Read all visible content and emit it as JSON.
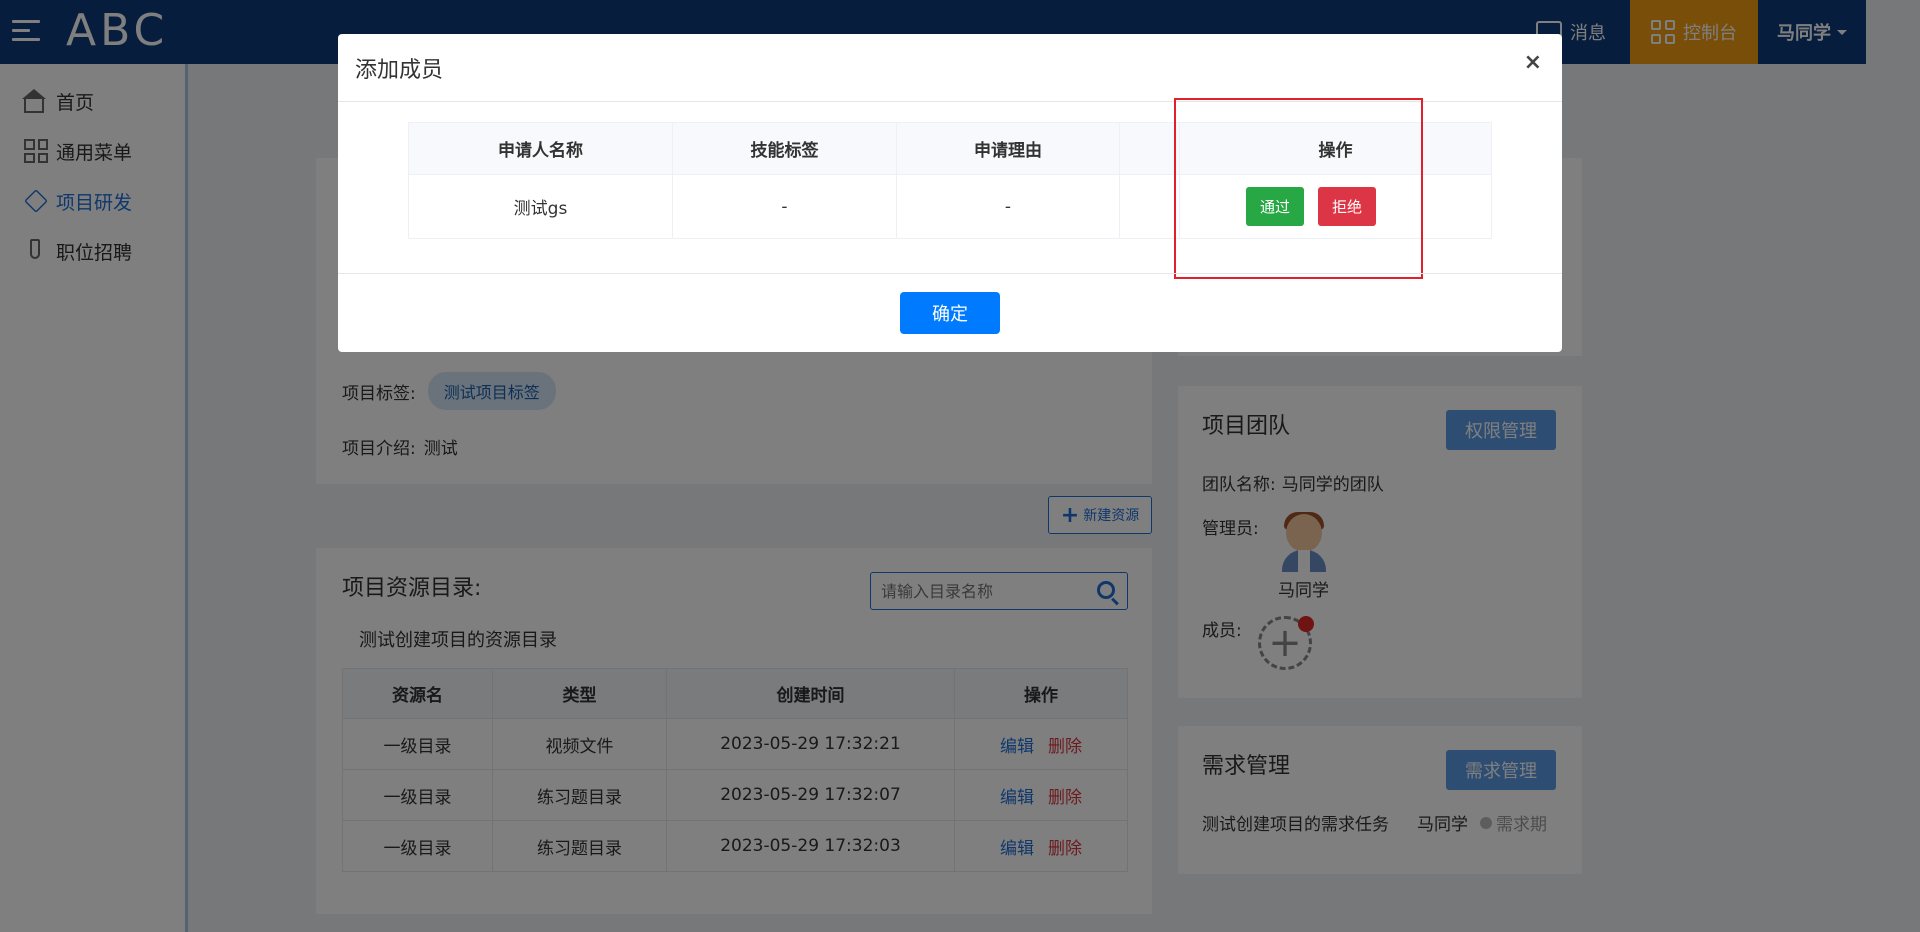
{
  "header": {
    "logo_text": "ABC",
    "message_label": "消息",
    "console_label": "控制台",
    "user_name": "马同学"
  },
  "sidebar": {
    "items": [
      {
        "label": "首页",
        "icon": "home-icon",
        "active": false
      },
      {
        "label": "通用菜单",
        "icon": "grid-icon",
        "active": false
      },
      {
        "label": "项目研发",
        "icon": "layers-icon",
        "active": true
      },
      {
        "label": "职位招聘",
        "icon": "tie-icon",
        "active": false
      }
    ]
  },
  "project": {
    "tags_label": "项目标签:",
    "tag": "测试项目标签",
    "intro_label": "项目介绍:",
    "intro": "测试",
    "new_resource_label": "新建资源"
  },
  "resources": {
    "title": "项目资源目录:",
    "search_placeholder": "请输入目录名称",
    "directory_name": "测试创建项目的资源目录",
    "columns": [
      "资源名",
      "类型",
      "创建时间",
      "操作"
    ],
    "rows": [
      {
        "name": "一级目录",
        "type": "视频文件",
        "created": "2023-05-29 17:32:21",
        "edit": "编辑",
        "delete": "删除"
      },
      {
        "name": "一级目录",
        "type": "练习题目录",
        "created": "2023-05-29 17:32:07",
        "edit": "编辑",
        "delete": "删除"
      },
      {
        "name": "一级目录",
        "type": "练习题目录",
        "created": "2023-05-29 17:32:03",
        "edit": "编辑",
        "delete": "删除"
      }
    ]
  },
  "team": {
    "title": "项目团队",
    "perm_button": "权限管理",
    "team_name_label": "团队名称:",
    "team_name": "马同学的团队",
    "admin_label": "管理员:",
    "admin_name": "马同学",
    "members_label": "成员:"
  },
  "demand": {
    "title": "需求管理",
    "button": "需求管理",
    "task": "测试创建项目的需求任务",
    "owner": "马同学",
    "status": "需求期"
  },
  "modal": {
    "title": "添加成员",
    "close": "×",
    "columns": [
      "申请人名称",
      "技能标签",
      "申请理由",
      "",
      "操作"
    ],
    "row": {
      "name": "测试gs",
      "skills": "-",
      "reason": "-",
      "extra": ""
    },
    "pass_label": "通过",
    "reject_label": "拒绝",
    "confirm_label": "确定"
  },
  "colors": {
    "header_bg": "#0d3b7a",
    "console_bg": "#f39c12",
    "pass": "#28a745",
    "reject": "#dc3545",
    "primary": "#007bff",
    "highlight_box": "#e0202a"
  }
}
